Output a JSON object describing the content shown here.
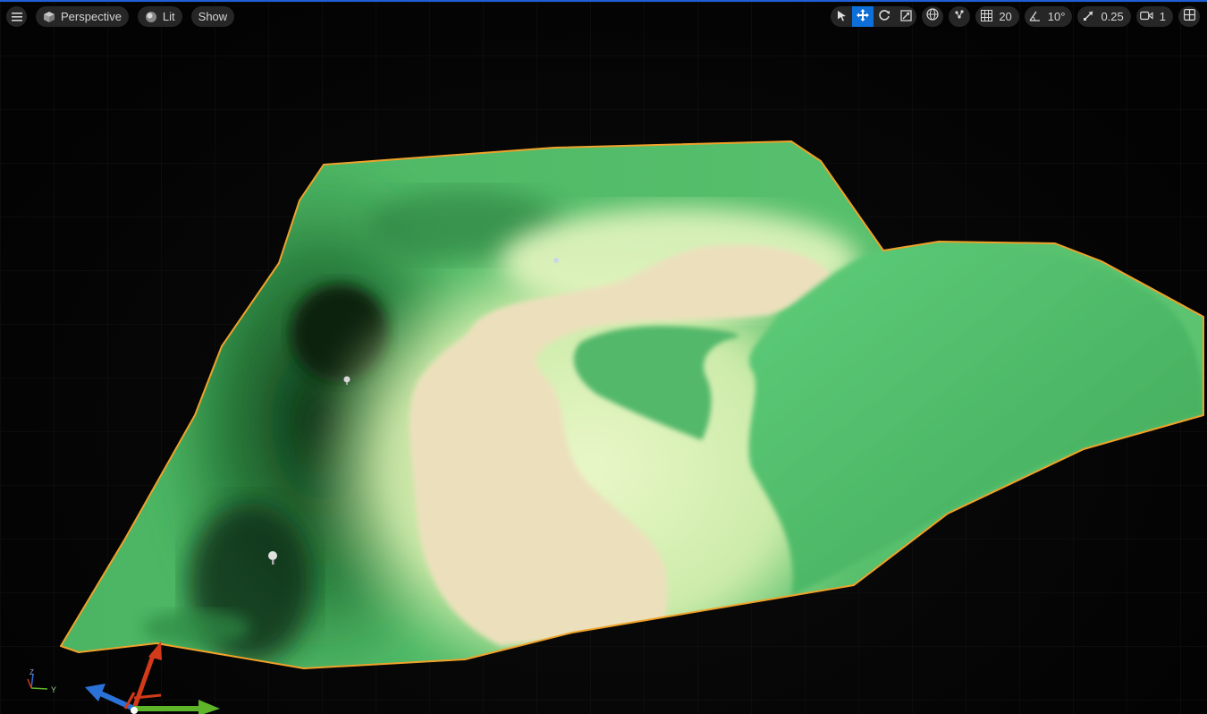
{
  "viewport": {
    "view_mode": "Perspective",
    "lighting_mode": "Lit",
    "show_label": "Show"
  },
  "toolbar_right": {
    "grid_snap": "20",
    "rotation_snap": "10°",
    "scale_snap": "0.25",
    "camera_speed": "1"
  },
  "axis_indicator": {
    "z_label": "Z",
    "y_label": "Y"
  },
  "colors": {
    "selection_outline": "#f0a22a",
    "active_tool": "#0e6fd8",
    "landscape_grass": "#58be6e",
    "landscape_light": "#e6f5c2",
    "landscape_sand": "#ece0bc",
    "gizmo_x": "#d23a1a",
    "gizmo_y": "#5fb52a",
    "gizmo_z": "#2b72d8"
  },
  "icons": [
    "menu-icon",
    "cube-icon",
    "lit-sphere-icon",
    "select-arrow-icon",
    "translate-icon",
    "rotate-icon",
    "scale-icon",
    "world-local-icon",
    "surface-snap-icon",
    "grid-icon",
    "angle-icon",
    "scale-arrow-icon",
    "camera-icon",
    "layout-icon"
  ]
}
